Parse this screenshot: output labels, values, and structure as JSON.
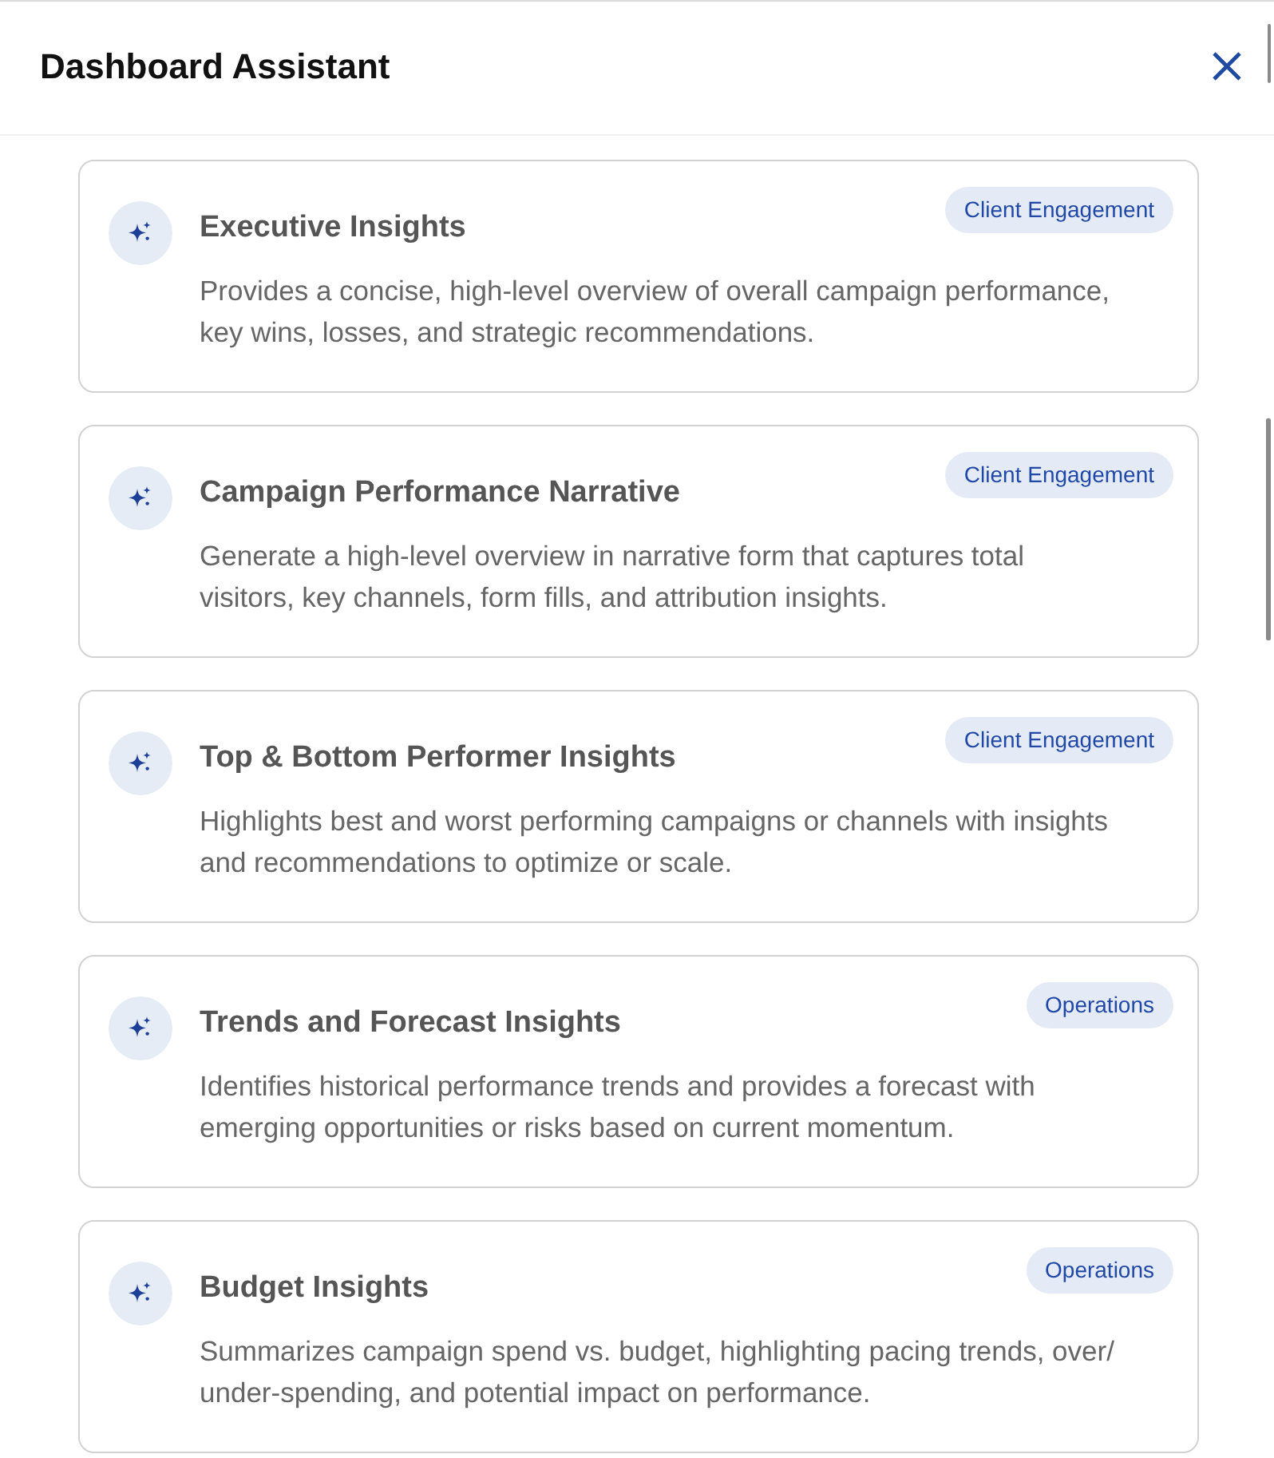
{
  "header": {
    "title": "Dashboard Assistant"
  },
  "cards": [
    {
      "title": "Executive Insights",
      "tag": "Client Engagement",
      "description": "Provides a concise, high-level overview of overall campaign performance, key wins, losses, and strategic recommendations."
    },
    {
      "title": "Campaign Performance Narrative",
      "tag": "Client Engagement",
      "description": "Generate a high-level overview in narrative form that captures total visitors, key channels, form fills, and attribution insights."
    },
    {
      "title": "Top & Bottom Performer Insights",
      "tag": "Client Engagement",
      "description": "Highlights best and worst performing campaigns or channels with insights and recommendations to optimize or scale."
    },
    {
      "title": "Trends and Forecast Insights",
      "tag": "Operations",
      "description": "Identifies historical performance trends and provides a forecast with emerging opportunities or risks based on current momentum."
    },
    {
      "title": "Budget Insights",
      "tag": "Operations",
      "description": "Summarizes campaign spend vs. budget, highlighting pacing trends, over/ under-spending, and potential impact on performance."
    }
  ]
}
